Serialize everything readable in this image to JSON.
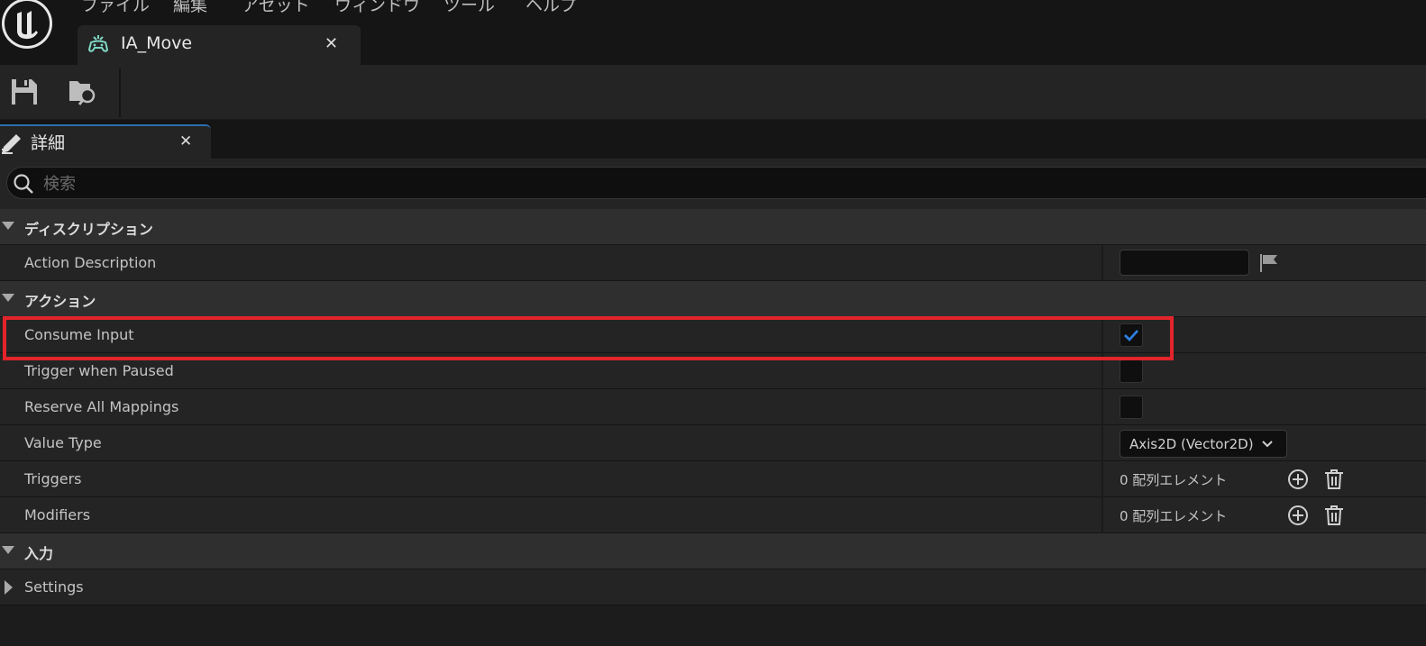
{
  "menu": {
    "items": [
      "ファイル",
      "編集",
      "アセット",
      "ウィンドウ",
      "ツール",
      "ヘルプ"
    ]
  },
  "document_tab": {
    "title": "IA_Move",
    "close": "✕"
  },
  "details_tab": {
    "title": "詳細",
    "close": "✕"
  },
  "search": {
    "placeholder": "検索"
  },
  "categories": {
    "description": "ディスクリプション",
    "action": "アクション",
    "input": "入力"
  },
  "properties": {
    "action_description": {
      "label": "Action Description",
      "value": ""
    },
    "consume_input": {
      "label": "Consume Input",
      "checked": true
    },
    "trigger_when_paused": {
      "label": "Trigger when Paused",
      "checked": false
    },
    "reserve_all_mappings": {
      "label": "Reserve All Mappings",
      "checked": false
    },
    "value_type": {
      "label": "Value Type",
      "value": "Axis2D (Vector2D)"
    },
    "triggers": {
      "label": "Triggers",
      "value": "0 配列エレメント"
    },
    "modifiers": {
      "label": "Modifiers",
      "value": "0 配列エレメント"
    },
    "settings": {
      "label": "Settings"
    }
  },
  "icons": {
    "logo": "unreal-engine-logo",
    "tab": "gamepad-icon",
    "save": "save-icon",
    "browse": "browse-icon",
    "details": "pencil-icon",
    "search": "search-icon",
    "flag": "flag-icon",
    "check": "check-icon",
    "chevron": "chevron-down-icon",
    "add": "add-icon",
    "delete": "trash-icon"
  },
  "colors": {
    "accent": "#2a6fb0",
    "check": "#2d7fe0",
    "highlight": "#e3242b",
    "tab_icon": "#7fd7c4"
  }
}
